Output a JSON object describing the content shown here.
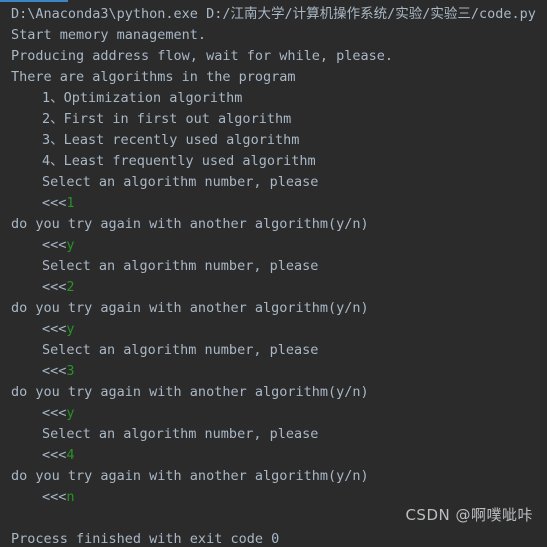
{
  "console": {
    "background_color": "#2b2b2b",
    "output_color": "#a9b7c6",
    "input_color": "#299326",
    "scrollbar_marker_color": "#3d86c6",
    "prompt_symbol": "<<<",
    "lines": [
      {
        "indent": false,
        "type": "output",
        "text": "D:\\Anaconda3\\python.exe D:/江南大学/计算机操作系统/实验/实验三/code.py"
      },
      {
        "indent": false,
        "type": "output",
        "text": "Start memory management."
      },
      {
        "indent": false,
        "type": "output",
        "text": "Producing address flow, wait for while, please."
      },
      {
        "indent": false,
        "type": "output",
        "text": "There are algorithms in the program"
      },
      {
        "indent": true,
        "type": "output",
        "text": "1、Optimization algorithm"
      },
      {
        "indent": true,
        "type": "output",
        "text": "2、First in first out algorithm"
      },
      {
        "indent": true,
        "type": "output",
        "text": "3、Least recently used algorithm"
      },
      {
        "indent": true,
        "type": "output",
        "text": "4、Least frequently used algorithm"
      },
      {
        "indent": true,
        "type": "output",
        "text": "Select an algorithm number, please"
      },
      {
        "indent": true,
        "type": "prompt",
        "prompt": "<<<",
        "input": "1"
      },
      {
        "indent": false,
        "type": "output",
        "text": "do you try again with another algorithm(y/n)"
      },
      {
        "indent": true,
        "type": "prompt",
        "prompt": "<<<",
        "input": "y"
      },
      {
        "indent": true,
        "type": "output",
        "text": "Select an algorithm number, please"
      },
      {
        "indent": true,
        "type": "prompt",
        "prompt": "<<<",
        "input": "2"
      },
      {
        "indent": false,
        "type": "output",
        "text": "do you try again with another algorithm(y/n)"
      },
      {
        "indent": true,
        "type": "prompt",
        "prompt": "<<<",
        "input": "y"
      },
      {
        "indent": true,
        "type": "output",
        "text": "Select an algorithm number, please"
      },
      {
        "indent": true,
        "type": "prompt",
        "prompt": "<<<",
        "input": "3"
      },
      {
        "indent": false,
        "type": "output",
        "text": "do you try again with another algorithm(y/n)"
      },
      {
        "indent": true,
        "type": "prompt",
        "prompt": "<<<",
        "input": "y"
      },
      {
        "indent": true,
        "type": "output",
        "text": "Select an algorithm number, please"
      },
      {
        "indent": true,
        "type": "prompt",
        "prompt": "<<<",
        "input": "4"
      },
      {
        "indent": false,
        "type": "output",
        "text": "do you try again with another algorithm(y/n)"
      },
      {
        "indent": true,
        "type": "prompt",
        "prompt": "<<<",
        "input": "n"
      },
      {
        "indent": false,
        "type": "blank",
        "text": ""
      },
      {
        "indent": false,
        "type": "output",
        "text": "Process finished with exit code 0"
      }
    ]
  },
  "watermark": {
    "text": "CSDN @啊噗呲咔"
  }
}
